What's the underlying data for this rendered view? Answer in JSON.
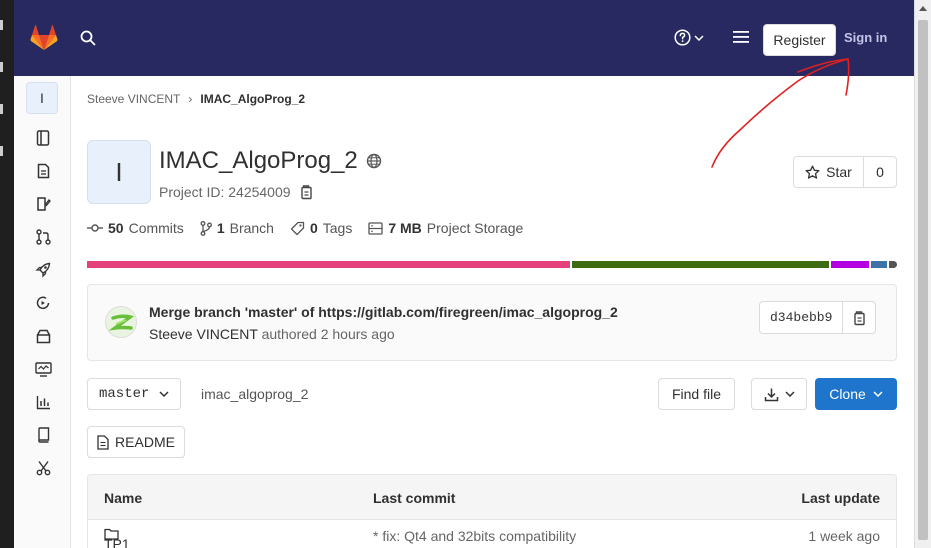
{
  "header": {
    "register_label": "Register",
    "signin_label": "Sign in"
  },
  "breadcrumb": {
    "namespace": "Steeve VINCENT",
    "separator": "›",
    "project": "IMAC_AlgoProg_2"
  },
  "project": {
    "avatar_letter": "I",
    "name": "IMAC_AlgoProg_2",
    "id_text": "Project ID: 24254009",
    "star_label": "Star",
    "star_count": "0"
  },
  "stats": {
    "commits_count": "50",
    "commits_label": "Commits",
    "branches_count": "1",
    "branches_label": "Branch",
    "tags_count": "0",
    "tags_label": "Tags",
    "storage_size": "7 MB",
    "storage_label": "Project Storage"
  },
  "languages": [
    {
      "color": "#e4407b",
      "share": 60
    },
    {
      "color": "#3d6b12",
      "share": 32
    },
    {
      "color": "#b300e0",
      "share": 4.7
    },
    {
      "color": "#3f72a8",
      "share": 2
    },
    {
      "color": "#555555",
      "share": 1
    }
  ],
  "last_commit": {
    "title": "Merge branch 'master' of https://gitlab.com/firegreen/imac_algoprog_2",
    "author": "Steeve VINCENT",
    "authored_text": "authored 2 hours ago",
    "sha": "d34bebb9"
  },
  "repo_toolbar": {
    "branch": "master",
    "path": "imac_algoprog_2",
    "find_file_label": "Find file",
    "clone_label": "Clone",
    "readme_label": "README"
  },
  "file_table": {
    "col_name": "Name",
    "col_commit": "Last commit",
    "col_update": "Last update",
    "rows": [
      {
        "name": "TP1",
        "commit": "* fix: Qt4 and 32bits compatibility",
        "updated": "1 week ago"
      }
    ]
  },
  "colors": {
    "navbar": "#292961",
    "primary_button": "#1f75cb",
    "annotation": "#e02020"
  },
  "icons": [
    "gitlab-logo",
    "search-icon",
    "help-icon",
    "hamburger-icon",
    "globe-icon",
    "copy-icon",
    "star-icon",
    "commit-icon",
    "branch-icon",
    "tag-icon",
    "storage-icon",
    "download-icon",
    "file-icon",
    "folder-icon"
  ]
}
